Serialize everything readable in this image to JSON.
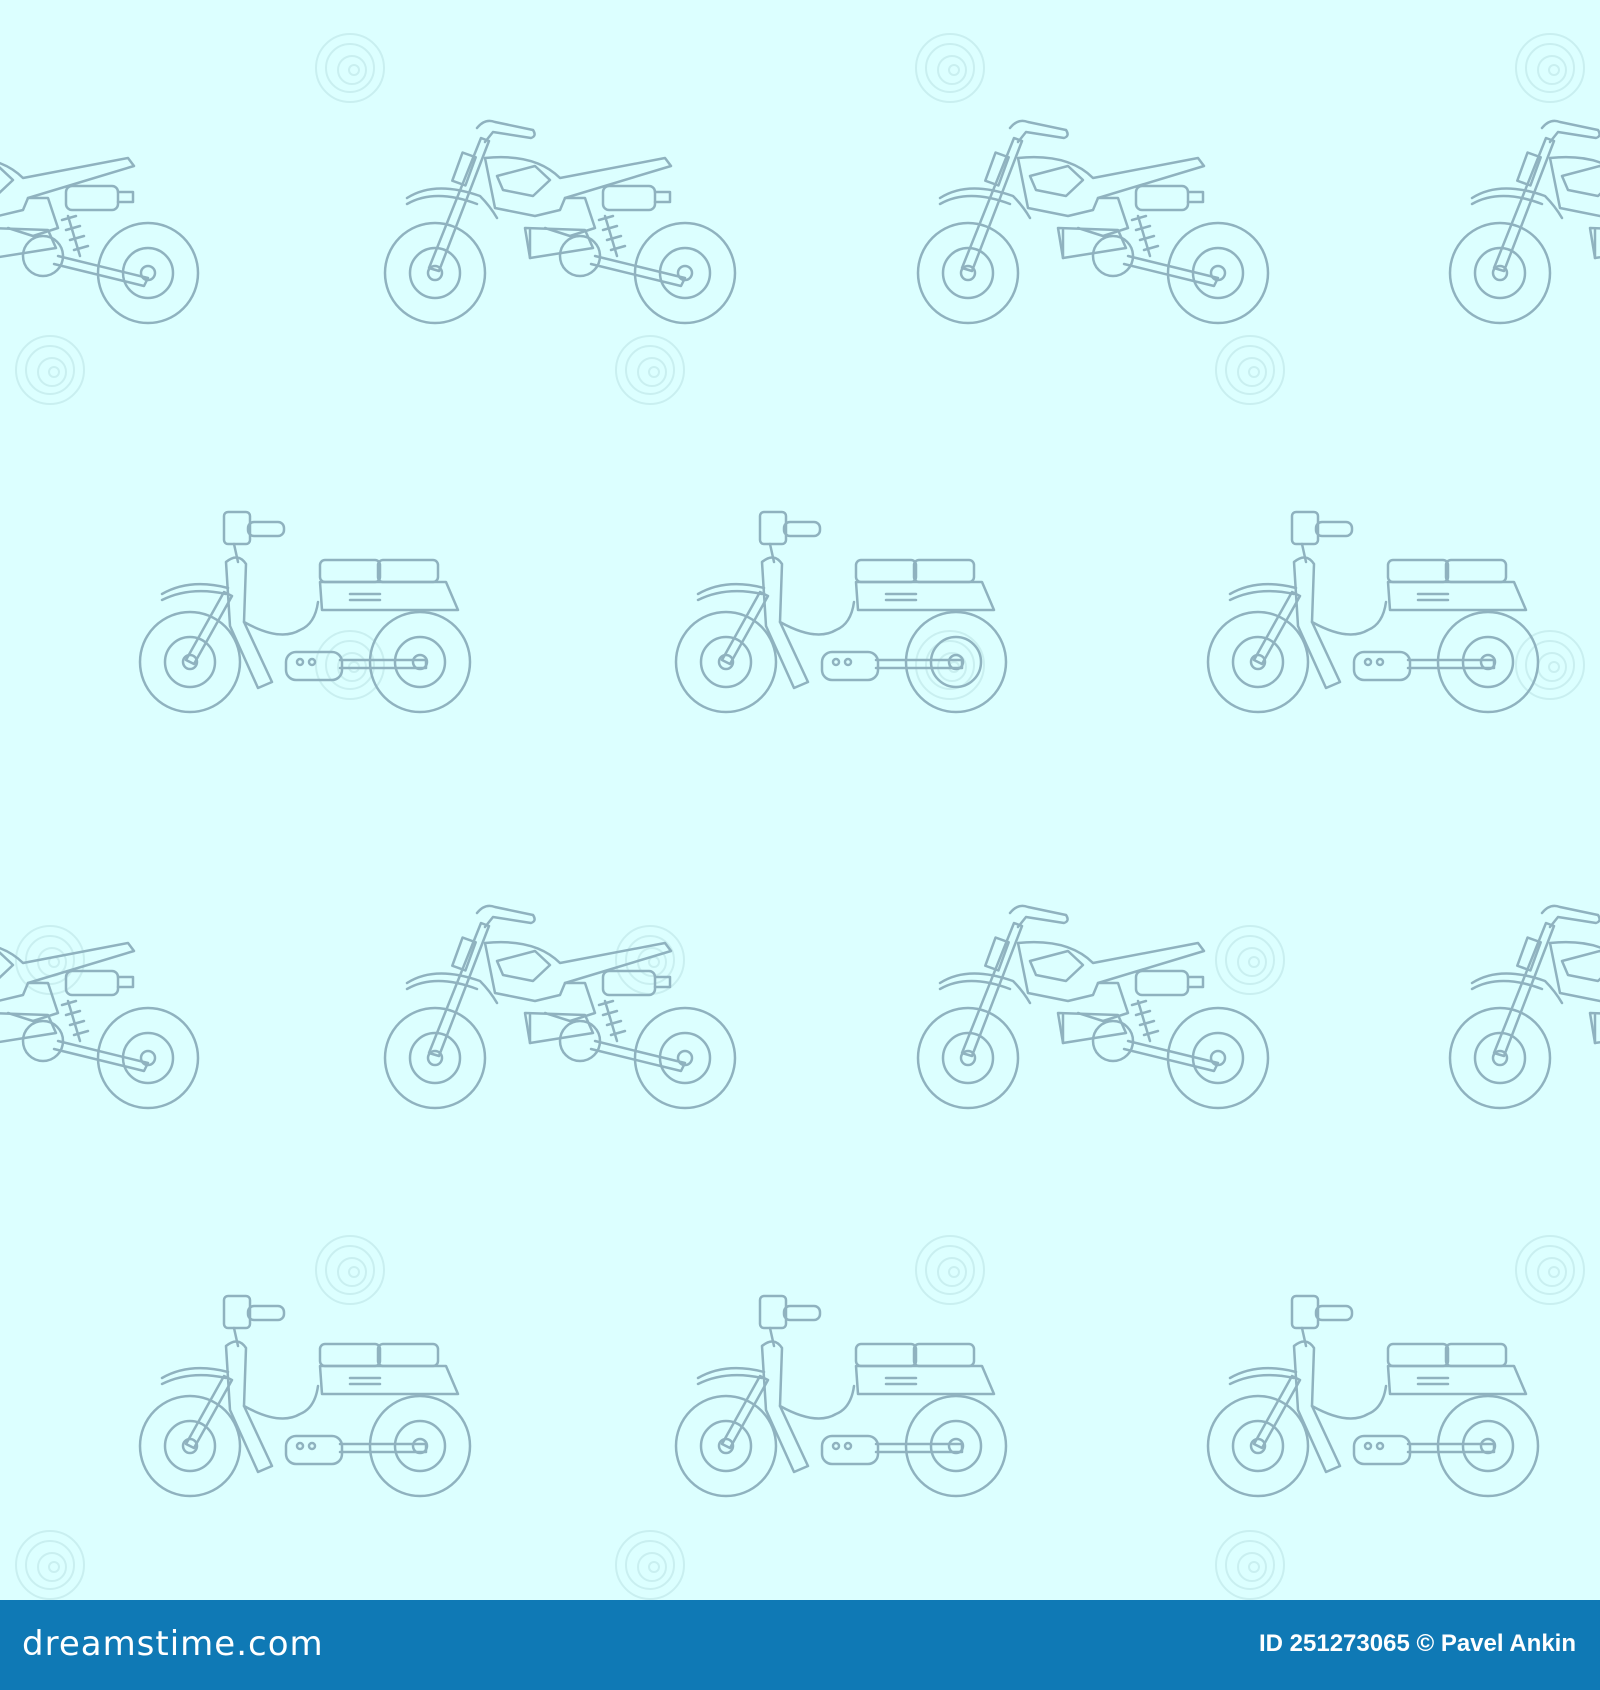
{
  "image": {
    "background_color": "#dcffff",
    "line_color": "#8fb2bf",
    "watermark_color": "#c9eff0",
    "pattern_icons": [
      "dirt-bike-icon",
      "moped-icon"
    ]
  },
  "footer": {
    "background_color": "#0f79b5",
    "logo_text": "dreamstime.com",
    "id_text": "ID 251273065",
    "copyright_symbol": "©",
    "author": "Pavel Ankin"
  }
}
